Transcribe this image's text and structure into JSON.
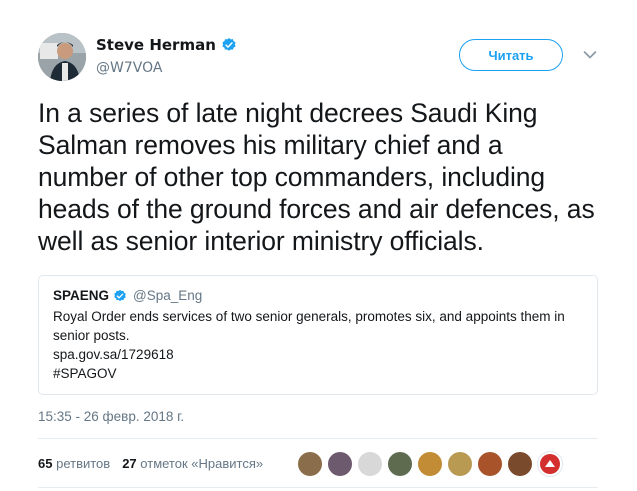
{
  "author": {
    "name": "Steve Herman",
    "handle": "@W7VOA",
    "verified": true
  },
  "follow_button": {
    "label": "Читать"
  },
  "tweet": {
    "text": "In a series of late night decrees Saudi King Salman removes his military chief and a number of other top commanders, including heads of the ground forces and air defences, as well as senior interior ministry officials."
  },
  "quoted_tweet": {
    "name": "SPAENG",
    "handle": "@Spa_Eng",
    "verified": true,
    "text": "Royal Order ends services of two senior generals, promotes six, and appoints them in senior posts.",
    "link": "spa.gov.sa/1729618",
    "hashtag": "#SPAGOV"
  },
  "timestamp": "15:35 - 26 февр. 2018 г.",
  "stats": {
    "retweets_count": "65",
    "retweets_label": "ретвитов",
    "likes_count": "27",
    "likes_label": "отметок «Нравится»"
  },
  "colors": {
    "accent": "#1da1f2",
    "text": "#14171a",
    "muted": "#657786",
    "border": "#e1e8ed"
  },
  "likers": [
    {
      "name": "liker-avatar-1",
      "color": "#8a6d4a"
    },
    {
      "name": "liker-avatar-2",
      "color": "#6e5a6e"
    },
    {
      "name": "liker-avatar-3",
      "color": "#d8d8d8"
    },
    {
      "name": "liker-avatar-4",
      "color": "#5f6b4e"
    },
    {
      "name": "liker-avatar-5",
      "color": "#c28b35"
    },
    {
      "name": "liker-avatar-6",
      "color": "#b89a52"
    },
    {
      "name": "liker-avatar-7",
      "color": "#a8532a"
    },
    {
      "name": "liker-avatar-8",
      "color": "#7a4a2c"
    },
    {
      "name": "liker-avatar-9",
      "color": "#c8c8c8"
    }
  ]
}
